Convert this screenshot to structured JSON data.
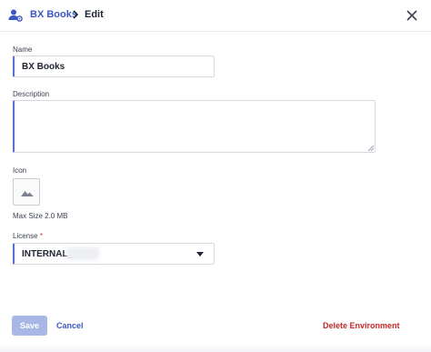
{
  "header": {
    "icon": "environment-settings-icon",
    "breadcrumb_link": "BX Books",
    "breadcrumb_separator_icon": "chevron-right-icon",
    "breadcrumb_current": "Edit",
    "close_icon": "close-icon"
  },
  "form": {
    "name": {
      "label": "Name",
      "value": "BX Books"
    },
    "description": {
      "label": "Description",
      "value": ""
    },
    "icon": {
      "label": "Icon",
      "placeholder_icon": "image-icon",
      "hint": "Max Size 2.0 MB"
    },
    "license": {
      "label": "License",
      "required_mark": "*",
      "value": "INTERNAL_"
    }
  },
  "footer": {
    "save_label": "Save",
    "cancel_label": "Cancel",
    "delete_label": "Delete Environment"
  },
  "colors": {
    "accent": "#3b57c4",
    "input_accent": "#5a6fd6",
    "save_disabled": "#a9b7e6",
    "danger": "#c62828"
  }
}
